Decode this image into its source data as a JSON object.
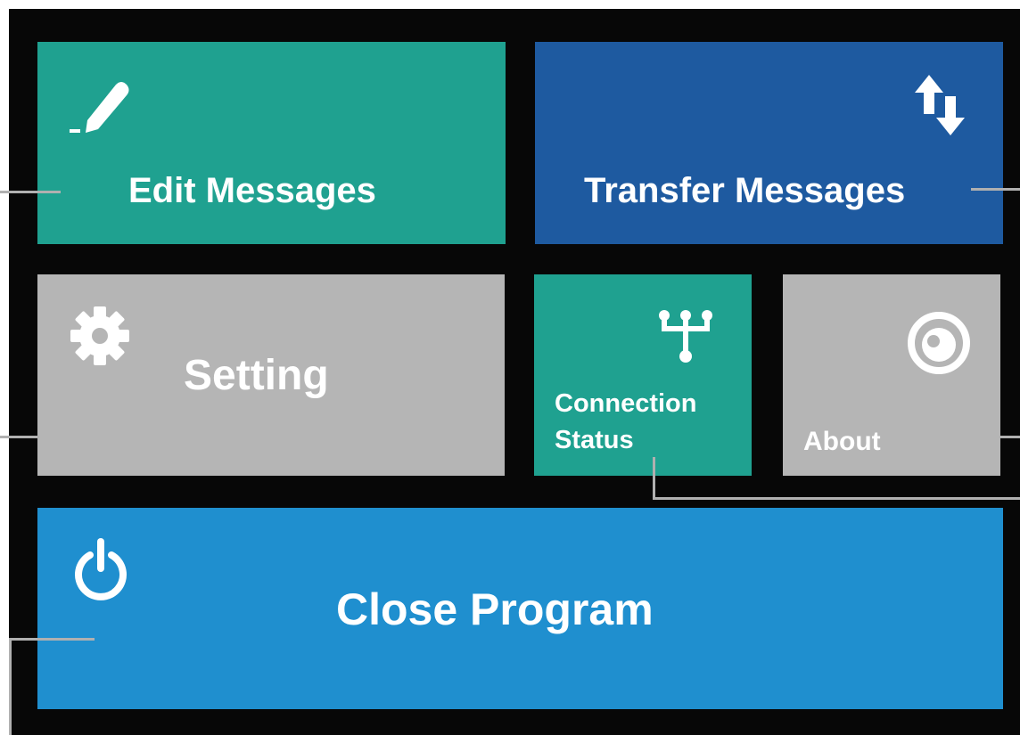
{
  "colors": {
    "background": "#070707",
    "teal": "#1fa190",
    "dark_blue": "#1e5aa0",
    "gray": "#b5b5b5",
    "light_blue": "#1f8fcf",
    "text": "#ffffff",
    "callout_line": "#b0b0b0"
  },
  "tiles": {
    "edit_messages": {
      "label": "Edit Messages",
      "icon": "pencil-icon"
    },
    "transfer_messages": {
      "label": "Transfer Messages",
      "icon": "transfer-arrows-icon"
    },
    "setting": {
      "label": "Setting",
      "icon": "gear-icon"
    },
    "connection_status": {
      "label_line1": "Connection",
      "label_line2": "Status",
      "icon": "usb-icon"
    },
    "about": {
      "label": "About",
      "icon": "about-circle-icon"
    },
    "close_program": {
      "label": "Close Program",
      "icon": "power-icon"
    }
  }
}
